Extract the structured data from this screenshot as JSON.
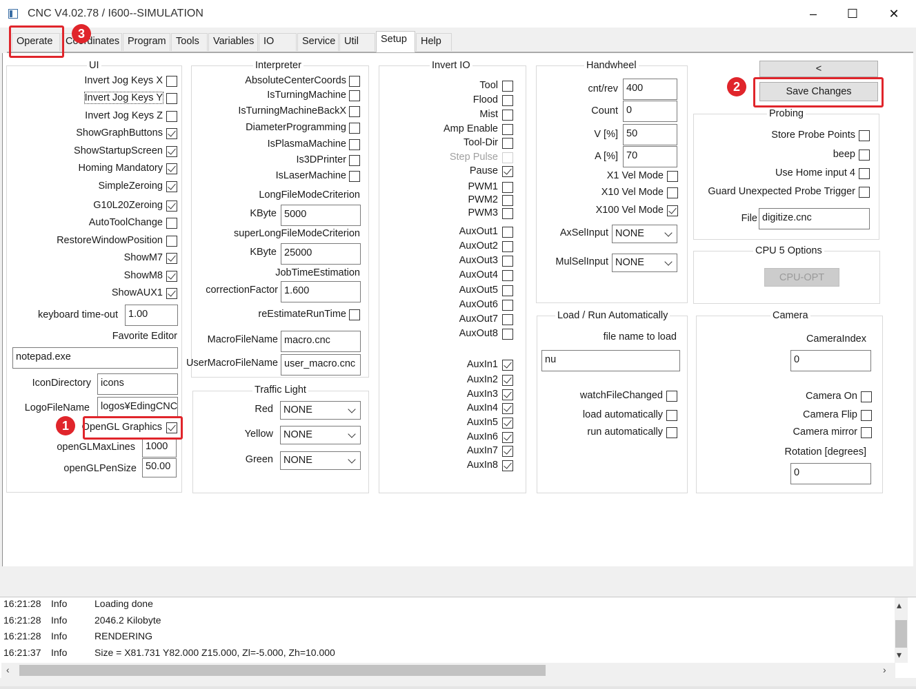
{
  "window": {
    "title": "CNC V4.02.78 / I600--SIMULATION",
    "minimize": "–",
    "maximize": "☐",
    "close": "✕"
  },
  "tabs": [
    "Operate",
    "Coordinates",
    "Program",
    "Tools",
    "Variables",
    "IO",
    "Service",
    "Util",
    "Setup",
    "Help"
  ],
  "active_tab": "Setup",
  "ui": {
    "title": "UI",
    "invert_x": "Invert Jog Keys X",
    "invert_y": "Invert Jog Keys Y",
    "invert_z": "Invert Jog Keys Z",
    "show_graph": "ShowGraphButtons",
    "show_startup": "ShowStartupScreen",
    "homing": "Homing Mandatory",
    "simple_zero": "SimpleZeroing",
    "g10l20": "G10L20Zeroing",
    "autotool": "AutoToolChange",
    "restore": "RestoreWindowPosition",
    "m7": "ShowM7",
    "m8": "ShowM8",
    "aux1": "ShowAUX1",
    "kbd_label": "keyboard time-out",
    "kbd_value": "1.00",
    "fav_label": "Favorite Editor",
    "fav_value": "notepad.exe",
    "icondir_label": "IconDirectory",
    "icondir_value": "icons",
    "logo_label": "LogoFileName",
    "logo_value": "logos¥EdingCNCL",
    "opengl": "OpenGL Graphics",
    "gl_lines_label": "openGLMaxLines",
    "gl_lines_value": "1000",
    "gl_pen_label": "openGLPenSize",
    "gl_pen_value": "50.00"
  },
  "interpreter": {
    "title": "Interpreter",
    "abs_center": "AbsoluteCenterCoords",
    "turning": "IsTurningMachine",
    "turning_back": "IsTurningMachineBackX",
    "diameter": "DiameterProgramming",
    "plasma": "IsPlasmaMachine",
    "printer": "Is3DPrinter",
    "laser": "IsLaserMachine",
    "long_title": "LongFileModeCriterion",
    "kbyte": "KByte",
    "long_value": "5000",
    "super_title": "superLongFileModeCriterion",
    "super_value": "25000",
    "job_title": "JobTimeEstimation",
    "corr_label": "correctionFactor",
    "corr_value": "1.600",
    "reestimate": "reEstimateRunTime",
    "macro_label": "MacroFileName",
    "macro_value": "macro.cnc",
    "umacro_label": "UserMacroFileName",
    "umacro_value": "user_macro.cnc"
  },
  "traffic": {
    "title": "Traffic Light",
    "red": "Red",
    "yellow": "Yellow",
    "green": "Green",
    "none": "NONE"
  },
  "invert_io": {
    "title": "Invert IO",
    "tool": "Tool",
    "flood": "Flood",
    "mist": "Mist",
    "amp": "Amp Enable",
    "tooldir": "Tool-Dir",
    "step": "Step Pulse",
    "pause": "Pause",
    "pwm1": "PWM1",
    "pwm2": "PWM2",
    "pwm3": "PWM3",
    "auxout1": "AuxOut1",
    "auxout2": "AuxOut2",
    "auxout3": "AuxOut3",
    "auxout4": "AuxOut4",
    "auxout5": "AuxOut5",
    "auxout6": "AuxOut6",
    "auxout7": "AuxOut7",
    "auxout8": "AuxOut8",
    "auxin1": "AuxIn1",
    "auxin2": "AuxIn2",
    "auxin3": "AuxIn3",
    "auxin4": "AuxIn4",
    "auxin5": "AuxIn5",
    "auxin6": "AuxIn6",
    "auxin7": "AuxIn7",
    "auxin8": "AuxIn8"
  },
  "handwheel": {
    "title": "Handwheel",
    "cntrev_label": "cnt/rev",
    "cntrev_value": "400",
    "count_label": "Count",
    "count_value": "0",
    "v_label": "V [%]",
    "v_value": "50",
    "a_label": "A [%]",
    "a_value": "70",
    "x1": "X1 Vel Mode",
    "x10": "X10 Vel Mode",
    "x100": "X100 Vel Mode",
    "axsel_label": "AxSelInput",
    "axsel_value": "NONE",
    "mulsel_label": "MulSelInput",
    "mulsel_value": "NONE"
  },
  "right": {
    "back_button": "<",
    "save_button": "Save Changes"
  },
  "probing": {
    "title": "Probing",
    "store": "Store Probe Points",
    "beep": "beep",
    "home4": "Use Home input 4",
    "guard": "Guard Unexpected Probe Trigger",
    "file_label": "File",
    "file_value": "digitize.cnc"
  },
  "cpu": {
    "title": "CPU 5 Options",
    "button": "CPU-OPT"
  },
  "loadrun": {
    "title": "Load / Run Automatically",
    "file_label": "file name to load",
    "file_value": "nu",
    "watch": "watchFileChanged",
    "load_auto": "load automatically",
    "run_auto": "run automatically"
  },
  "camera": {
    "title": "Camera",
    "index_label": "CameraIndex",
    "index_value": "0",
    "on": "Camera On",
    "flip": "Camera Flip",
    "mirror": "Camera mirror",
    "rot_label": "Rotation [degrees]",
    "rot_value": "0"
  },
  "annotations": {
    "badge1": "1",
    "badge2": "2",
    "badge3": "3",
    "highlight_color": "#e0252b"
  },
  "log": [
    {
      "time": "16:21:28",
      "level": "Info",
      "msg": "Loading done"
    },
    {
      "time": "16:21:28",
      "level": "Info",
      "msg": "2046.2 Kilobyte"
    },
    {
      "time": "16:21:28",
      "level": "Info",
      "msg": "RENDERING"
    },
    {
      "time": "16:21:37",
      "level": "Info",
      "msg": "Size = X81.731 Y82.000 Z15.000, Zl=-5.000, Zh=10.000"
    }
  ]
}
